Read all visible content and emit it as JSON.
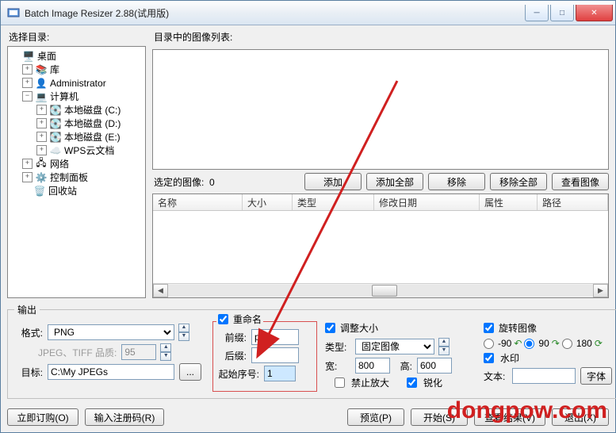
{
  "window": {
    "title": "Batch Image Resizer 2.88(试用版)"
  },
  "left": {
    "header": "选择目录:",
    "tree": {
      "desktop": "桌面",
      "libs": "库",
      "user": "Administrator",
      "computer": "计算机",
      "driveC": "本地磁盘 (C:)",
      "driveD": "本地磁盘 (D:)",
      "driveE": "本地磁盘 (E:)",
      "wps": "WPS云文档",
      "network": "网络",
      "controlpanel": "控制面板",
      "recycle": "回收站"
    }
  },
  "right": {
    "listHeader": "目录中的图像列表:",
    "selected_prefix": "选定的图像:",
    "selected_count": "0",
    "btn_add": "添加",
    "btn_addall": "添加全部",
    "btn_remove": "移除",
    "btn_removeall": "移除全部",
    "btn_view": "查看图像",
    "cols": {
      "name": "名称",
      "size": "大小",
      "type": "类型",
      "modified": "修改日期",
      "attr": "属性",
      "path": "路径"
    }
  },
  "output": {
    "legend": "输出",
    "format_label": "格式:",
    "format_value": "PNG",
    "quality_label": "JPEG、TIFF 品质:",
    "quality_value": "95",
    "target_label": "目标:",
    "target_value": "C:\\My JPEGs",
    "browse": "...",
    "rename": {
      "header": "重命名",
      "prefix_label": "前缀:",
      "prefix_value": "pic",
      "suffix_label": "后缀:",
      "suffix_value": "",
      "startnum_label": "起始序号:",
      "startnum_value": "1"
    },
    "resize": {
      "header": "调整大小",
      "type_label": "类型:",
      "type_value": "固定图像",
      "width_label": "宽:",
      "width_value": "800",
      "height_label": "高:",
      "height_value": "600",
      "noupscale": "禁止放大",
      "sharpen": "锐化"
    },
    "rotate": {
      "header": "旋转图像",
      "m90": "-90",
      "p90": "90",
      "p180": "180",
      "watermark": "水印",
      "text_label": "文本:",
      "font_btn": "字体"
    }
  },
  "bottom": {
    "order": "立即订购(O)",
    "regcode": "输入注册码(R)",
    "preview": "预览(P)",
    "start": "开始(S)",
    "viewresult": "查看结果(V)",
    "exit": "退出(X)"
  },
  "watermark": "dongpow.com"
}
